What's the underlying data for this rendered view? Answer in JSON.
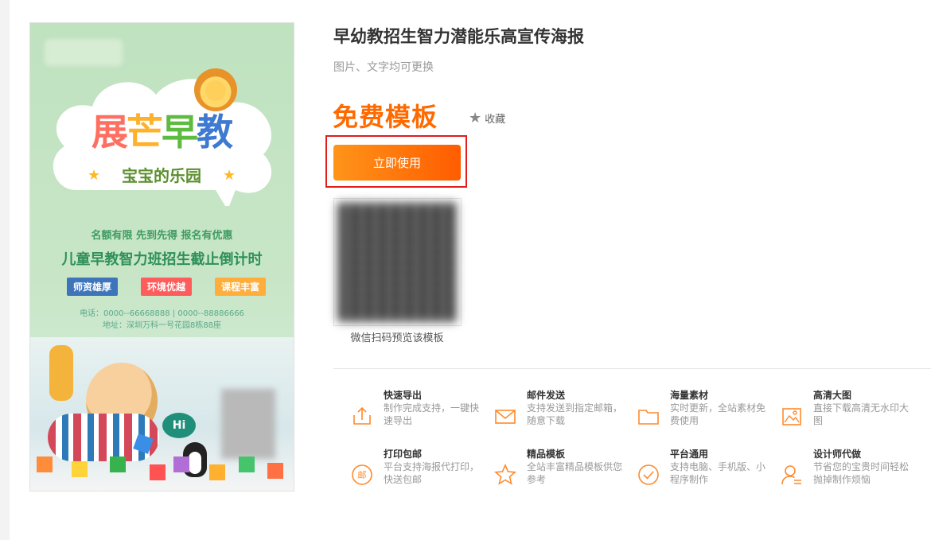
{
  "poster": {
    "title_chars": [
      "展",
      "芒",
      "早",
      "教"
    ],
    "subtitle": "宝宝的乐园",
    "line1": "名额有限 先到先得 报名有优惠",
    "line2": "儿童早教智力班招生截止倒计时",
    "tags": [
      {
        "label": "师资雄厚",
        "color": "#3e74b9"
      },
      {
        "label": "环境优越",
        "color": "#ff5c5c"
      },
      {
        "label": "课程丰富",
        "color": "#ffae3b"
      }
    ],
    "phone": "电话：0000--66668888 | 0000--88886666",
    "address": "地址：深圳万科一号花园8栋88座",
    "bubble": "Hi"
  },
  "product": {
    "title": "早幼教招生智力潜能乐高宣传海报",
    "subtitle": "图片、文字均可更换",
    "price": "免费模板",
    "favorite_label": "收藏",
    "use_button": "立即使用",
    "qr_caption": "微信扫码预览该模板"
  },
  "features": [
    {
      "icon": "upload-icon",
      "title": "快速导出",
      "desc": "制作完成支持，一键快速导出"
    },
    {
      "icon": "mail-icon",
      "title": "邮件发送",
      "desc": "支持发送到指定邮箱，随意下载"
    },
    {
      "icon": "folder-icon",
      "title": "海量素材",
      "desc": "实时更新，全站素材免费使用"
    },
    {
      "icon": "image-icon",
      "title": "高清大图",
      "desc": "直接下载高清无水印大图"
    },
    {
      "icon": "mail-stamp-icon",
      "title": "打印包邮",
      "desc": "平台支持海报代打印，快送包邮"
    },
    {
      "icon": "star-icon",
      "title": "精品模板",
      "desc": "全站丰富精品模板供您参考"
    },
    {
      "icon": "check-circle-icon",
      "title": "平台通用",
      "desc": "支持电脑、手机版、小程序制作"
    },
    {
      "icon": "user-icon",
      "title": "设计师代做",
      "desc": "节省您的宝贵时间轻松抛掉制作烦恼"
    }
  ],
  "colors": {
    "accent": "#ff6a00",
    "highlight_frame": "#e21b1b"
  }
}
